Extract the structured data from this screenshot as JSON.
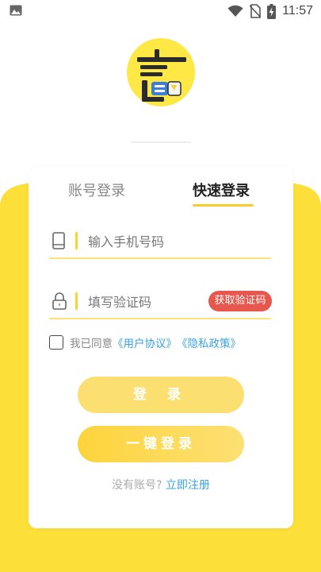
{
  "status_bar": {
    "time": "11:57"
  },
  "login": {
    "tabs": [
      {
        "label": "账号登录"
      },
      {
        "label": "快速登录"
      }
    ],
    "phone_placeholder": "输入手机号码",
    "code_placeholder": "填写验证码",
    "get_code_label": "获取验证码",
    "agree_prefix": "我已同意",
    "user_agreement": "《用户协议》",
    "privacy_policy": "《隐私政策》",
    "login_button": "登 录",
    "onekey_button": "一键登录",
    "no_account": "没有账号?",
    "register_link": "立即注册"
  },
  "colors": {
    "brand_yellow": "#fddf3a",
    "accent_red": "#e8574d",
    "link_blue": "#39a3dc"
  }
}
